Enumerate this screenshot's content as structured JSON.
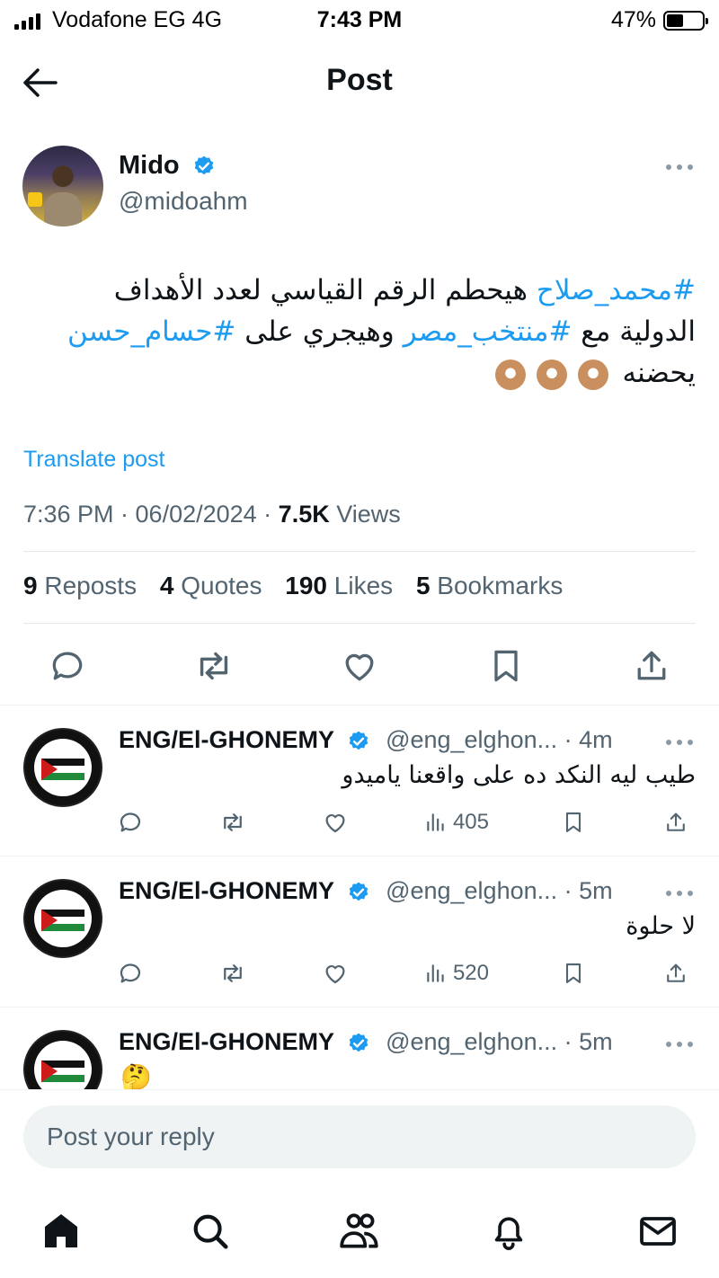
{
  "status_bar": {
    "carrier": "Vodafone EG  4G",
    "time": "7:43 PM",
    "battery": "47%",
    "battery_level": 0.47
  },
  "header": {
    "title": "Post"
  },
  "post": {
    "author_name": "Mido",
    "author_handle": "@midoahm",
    "text_line1_tag": "#محمد_صلاح",
    "text_line1_rest": " هيحطم الرقم القياسي لعدد الأهداف",
    "text_line2_a": "الدولية مع ",
    "text_line2_tag1": "#منتخب_مصر",
    "text_line2_b": " وهيجري على ",
    "text_line2_tag2": "#حسام_حسن",
    "text_line3": "يحضنه",
    "translate_label": "Translate post",
    "time": "7:36 PM · 06/02/2024 · ",
    "views_count": "7.5K",
    "views_label": " Views",
    "reposts_count": "9",
    "reposts_label": " Reposts",
    "quotes_count": "4",
    "quotes_label": " Quotes",
    "likes_count": "190",
    "likes_label": " Likes",
    "bookmarks_count": "5",
    "bookmarks_label": " Bookmarks"
  },
  "replies": [
    {
      "name": "ENG/El-GHONEMY",
      "handle": "@eng_elghon...",
      "time": " · 4m",
      "text": "طيب ليه النكد ده على واقعنا ياميدو",
      "views": "405"
    },
    {
      "name": "ENG/El-GHONEMY",
      "handle": "@eng_elghon...",
      "time": " · 5m",
      "text": "لا حلوة",
      "views": "520"
    },
    {
      "name": "ENG/El-GHONEMY",
      "handle": "@eng_elghon...",
      "time": " · 5m",
      "text": "🤔",
      "views": ""
    }
  ],
  "composer": {
    "placeholder": "Post your reply"
  },
  "colors": {
    "accent": "#1d9bf0",
    "text": "#0f1419",
    "secondary": "#536471"
  }
}
